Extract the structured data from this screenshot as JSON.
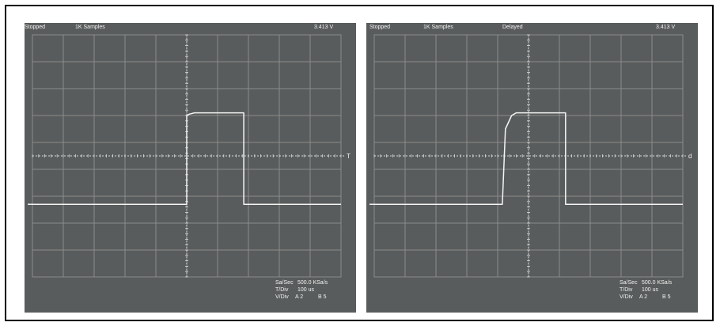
{
  "chart_data": [
    {
      "type": "line",
      "status": "Stopped",
      "samples": "1K Samples",
      "mode": "",
      "voltage": "3.413 V",
      "trigger_marker": "T",
      "sa_sec_label": "Sa/Sec",
      "sa_sec_value": "500.0 KSa/s",
      "t_div_label": "T/Div",
      "t_div_value": "100 us",
      "v_div_label": "V/Div",
      "v_div_a": "A 2",
      "v_div_b": "B 5",
      "grid": true,
      "x_divisions": 10,
      "y_divisions": 9,
      "x": [
        0,
        5.0,
        5.0,
        5.08,
        5.25,
        6.85,
        6.85,
        10
      ],
      "y": [
        -1.8,
        -1.8,
        1.5,
        1.55,
        1.6,
        1.6,
        -1.8,
        -1.8
      ],
      "ylim": [
        -4.5,
        4.5
      ],
      "xlim": [
        0,
        10
      ]
    },
    {
      "type": "line",
      "status": "Stopped",
      "samples": "1K Samples",
      "mode": "Delayed",
      "voltage": "3.413 V",
      "trigger_marker": "d",
      "sa_sec_label": "Sa/Sec",
      "sa_sec_value": "500.0 KSa/s",
      "t_div_label": "T/Div",
      "t_div_value": "100 us",
      "v_div_label": "V/Div",
      "v_div_a": "A 2",
      "v_div_b": "B 5",
      "grid": true,
      "x_divisions": 10,
      "y_divisions": 9,
      "x": [
        0,
        4.15,
        4.25,
        4.45,
        4.6,
        6.2,
        6.2,
        10
      ],
      "y": [
        -1.8,
        -1.8,
        1.0,
        1.5,
        1.6,
        1.6,
        -1.8,
        -1.8
      ],
      "ylim": [
        -4.5,
        4.5
      ],
      "xlim": [
        0,
        10
      ]
    }
  ],
  "colors": {
    "screen": "#595c5c",
    "grid": "#8a8d8d",
    "trace": "#f4f4f4",
    "text": "#f2f2f2"
  }
}
